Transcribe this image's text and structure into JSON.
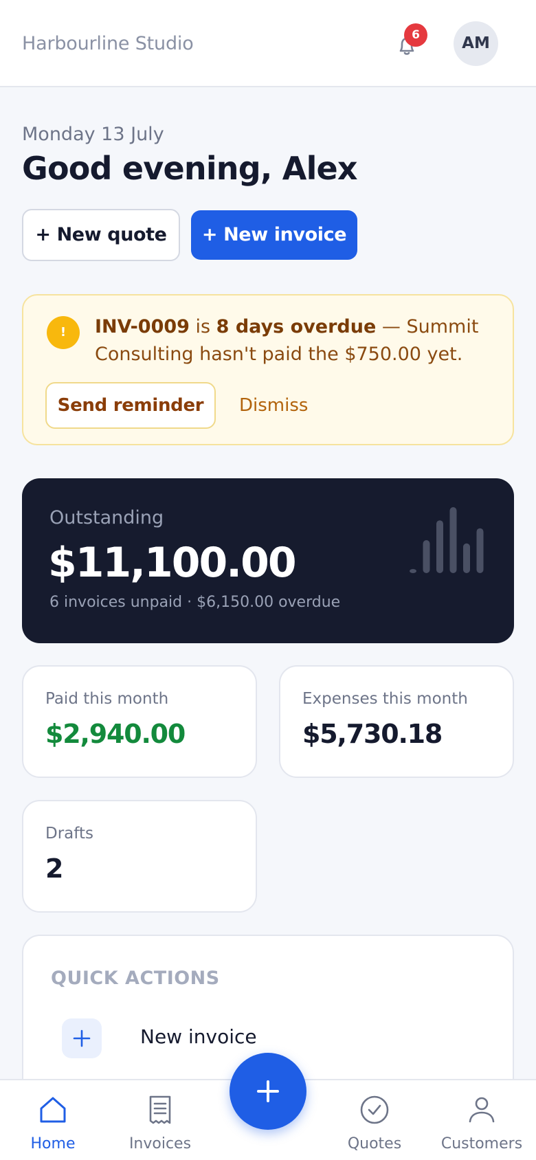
{
  "header": {
    "brand": "Harbourline Studio",
    "notification_count": "6",
    "avatar_initials": "AM",
    "bell_icon": "bell-icon"
  },
  "greeting": {
    "date": "Monday 13 July",
    "title": "Good evening, Alex"
  },
  "actions": {
    "new_quote": "+ New quote",
    "new_invoice": "+ New invoice"
  },
  "alert": {
    "invoice_id": "INV-0009",
    "is_text": " is ",
    "overdue_text": "8 days overdue",
    "rest_text": " — Summit Consulting hasn't paid the $750.00 yet.",
    "send_reminder": "Send reminder",
    "dismiss": "Dismiss",
    "icon": "!"
  },
  "outstanding": {
    "label": "Outstanding",
    "amount": "$11,100.00",
    "subtitle": "6 invoices unpaid · $6,150.00 overdue",
    "bar_levels": [
      0.05,
      0.5,
      0.8,
      1.0,
      0.45,
      0.68
    ]
  },
  "stats": {
    "paid_label": "Paid this month",
    "paid_value": "$2,940.00",
    "expenses_label": "Expenses this month",
    "expenses_value": "$5,730.18",
    "drafts_label": "Drafts",
    "drafts_value": "2"
  },
  "quick_actions": {
    "title": "QUICK ACTIONS",
    "items": [
      {
        "label": "New invoice",
        "icon": "plus-icon"
      }
    ]
  },
  "nav": {
    "home": "Home",
    "invoices": "Invoices",
    "quotes": "Quotes",
    "customers": "Customers",
    "fab_icon": "plus-icon"
  },
  "colors": {
    "accent": "#1f5ee5",
    "paid_green": "#138a3c",
    "badge_red": "#e5393f",
    "warning_amber": "#f8b80d",
    "hero_bg": "#161b2e"
  }
}
